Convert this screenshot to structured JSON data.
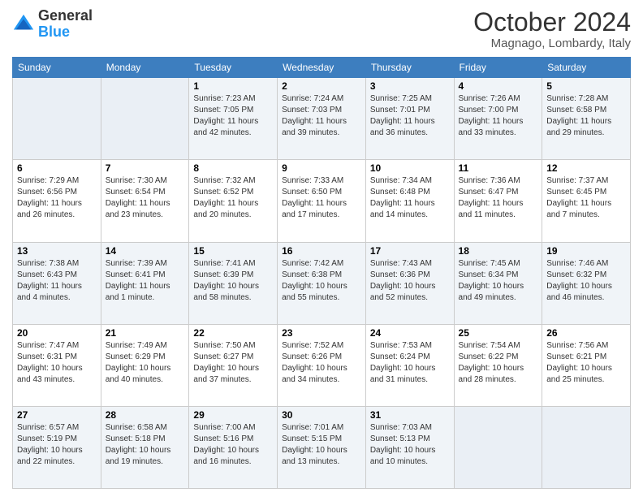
{
  "header": {
    "logo_general": "General",
    "logo_blue": "Blue",
    "month_title": "October 2024",
    "location": "Magnago, Lombardy, Italy"
  },
  "days_of_week": [
    "Sunday",
    "Monday",
    "Tuesday",
    "Wednesday",
    "Thursday",
    "Friday",
    "Saturday"
  ],
  "weeks": [
    [
      {
        "day": "",
        "sunrise": "",
        "sunset": "",
        "daylight": ""
      },
      {
        "day": "",
        "sunrise": "",
        "sunset": "",
        "daylight": ""
      },
      {
        "day": "1",
        "sunrise": "Sunrise: 7:23 AM",
        "sunset": "Sunset: 7:05 PM",
        "daylight": "Daylight: 11 hours and 42 minutes."
      },
      {
        "day": "2",
        "sunrise": "Sunrise: 7:24 AM",
        "sunset": "Sunset: 7:03 PM",
        "daylight": "Daylight: 11 hours and 39 minutes."
      },
      {
        "day": "3",
        "sunrise": "Sunrise: 7:25 AM",
        "sunset": "Sunset: 7:01 PM",
        "daylight": "Daylight: 11 hours and 36 minutes."
      },
      {
        "day": "4",
        "sunrise": "Sunrise: 7:26 AM",
        "sunset": "Sunset: 7:00 PM",
        "daylight": "Daylight: 11 hours and 33 minutes."
      },
      {
        "day": "5",
        "sunrise": "Sunrise: 7:28 AM",
        "sunset": "Sunset: 6:58 PM",
        "daylight": "Daylight: 11 hours and 29 minutes."
      }
    ],
    [
      {
        "day": "6",
        "sunrise": "Sunrise: 7:29 AM",
        "sunset": "Sunset: 6:56 PM",
        "daylight": "Daylight: 11 hours and 26 minutes."
      },
      {
        "day": "7",
        "sunrise": "Sunrise: 7:30 AM",
        "sunset": "Sunset: 6:54 PM",
        "daylight": "Daylight: 11 hours and 23 minutes."
      },
      {
        "day": "8",
        "sunrise": "Sunrise: 7:32 AM",
        "sunset": "Sunset: 6:52 PM",
        "daylight": "Daylight: 11 hours and 20 minutes."
      },
      {
        "day": "9",
        "sunrise": "Sunrise: 7:33 AM",
        "sunset": "Sunset: 6:50 PM",
        "daylight": "Daylight: 11 hours and 17 minutes."
      },
      {
        "day": "10",
        "sunrise": "Sunrise: 7:34 AM",
        "sunset": "Sunset: 6:48 PM",
        "daylight": "Daylight: 11 hours and 14 minutes."
      },
      {
        "day": "11",
        "sunrise": "Sunrise: 7:36 AM",
        "sunset": "Sunset: 6:47 PM",
        "daylight": "Daylight: 11 hours and 11 minutes."
      },
      {
        "day": "12",
        "sunrise": "Sunrise: 7:37 AM",
        "sunset": "Sunset: 6:45 PM",
        "daylight": "Daylight: 11 hours and 7 minutes."
      }
    ],
    [
      {
        "day": "13",
        "sunrise": "Sunrise: 7:38 AM",
        "sunset": "Sunset: 6:43 PM",
        "daylight": "Daylight: 11 hours and 4 minutes."
      },
      {
        "day": "14",
        "sunrise": "Sunrise: 7:39 AM",
        "sunset": "Sunset: 6:41 PM",
        "daylight": "Daylight: 11 hours and 1 minute."
      },
      {
        "day": "15",
        "sunrise": "Sunrise: 7:41 AM",
        "sunset": "Sunset: 6:39 PM",
        "daylight": "Daylight: 10 hours and 58 minutes."
      },
      {
        "day": "16",
        "sunrise": "Sunrise: 7:42 AM",
        "sunset": "Sunset: 6:38 PM",
        "daylight": "Daylight: 10 hours and 55 minutes."
      },
      {
        "day": "17",
        "sunrise": "Sunrise: 7:43 AM",
        "sunset": "Sunset: 6:36 PM",
        "daylight": "Daylight: 10 hours and 52 minutes."
      },
      {
        "day": "18",
        "sunrise": "Sunrise: 7:45 AM",
        "sunset": "Sunset: 6:34 PM",
        "daylight": "Daylight: 10 hours and 49 minutes."
      },
      {
        "day": "19",
        "sunrise": "Sunrise: 7:46 AM",
        "sunset": "Sunset: 6:32 PM",
        "daylight": "Daylight: 10 hours and 46 minutes."
      }
    ],
    [
      {
        "day": "20",
        "sunrise": "Sunrise: 7:47 AM",
        "sunset": "Sunset: 6:31 PM",
        "daylight": "Daylight: 10 hours and 43 minutes."
      },
      {
        "day": "21",
        "sunrise": "Sunrise: 7:49 AM",
        "sunset": "Sunset: 6:29 PM",
        "daylight": "Daylight: 10 hours and 40 minutes."
      },
      {
        "day": "22",
        "sunrise": "Sunrise: 7:50 AM",
        "sunset": "Sunset: 6:27 PM",
        "daylight": "Daylight: 10 hours and 37 minutes."
      },
      {
        "day": "23",
        "sunrise": "Sunrise: 7:52 AM",
        "sunset": "Sunset: 6:26 PM",
        "daylight": "Daylight: 10 hours and 34 minutes."
      },
      {
        "day": "24",
        "sunrise": "Sunrise: 7:53 AM",
        "sunset": "Sunset: 6:24 PM",
        "daylight": "Daylight: 10 hours and 31 minutes."
      },
      {
        "day": "25",
        "sunrise": "Sunrise: 7:54 AM",
        "sunset": "Sunset: 6:22 PM",
        "daylight": "Daylight: 10 hours and 28 minutes."
      },
      {
        "day": "26",
        "sunrise": "Sunrise: 7:56 AM",
        "sunset": "Sunset: 6:21 PM",
        "daylight": "Daylight: 10 hours and 25 minutes."
      }
    ],
    [
      {
        "day": "27",
        "sunrise": "Sunrise: 6:57 AM",
        "sunset": "Sunset: 5:19 PM",
        "daylight": "Daylight: 10 hours and 22 minutes."
      },
      {
        "day": "28",
        "sunrise": "Sunrise: 6:58 AM",
        "sunset": "Sunset: 5:18 PM",
        "daylight": "Daylight: 10 hours and 19 minutes."
      },
      {
        "day": "29",
        "sunrise": "Sunrise: 7:00 AM",
        "sunset": "Sunset: 5:16 PM",
        "daylight": "Daylight: 10 hours and 16 minutes."
      },
      {
        "day": "30",
        "sunrise": "Sunrise: 7:01 AM",
        "sunset": "Sunset: 5:15 PM",
        "daylight": "Daylight: 10 hours and 13 minutes."
      },
      {
        "day": "31",
        "sunrise": "Sunrise: 7:03 AM",
        "sunset": "Sunset: 5:13 PM",
        "daylight": "Daylight: 10 hours and 10 minutes."
      },
      {
        "day": "",
        "sunrise": "",
        "sunset": "",
        "daylight": ""
      },
      {
        "day": "",
        "sunrise": "",
        "sunset": "",
        "daylight": ""
      }
    ]
  ]
}
